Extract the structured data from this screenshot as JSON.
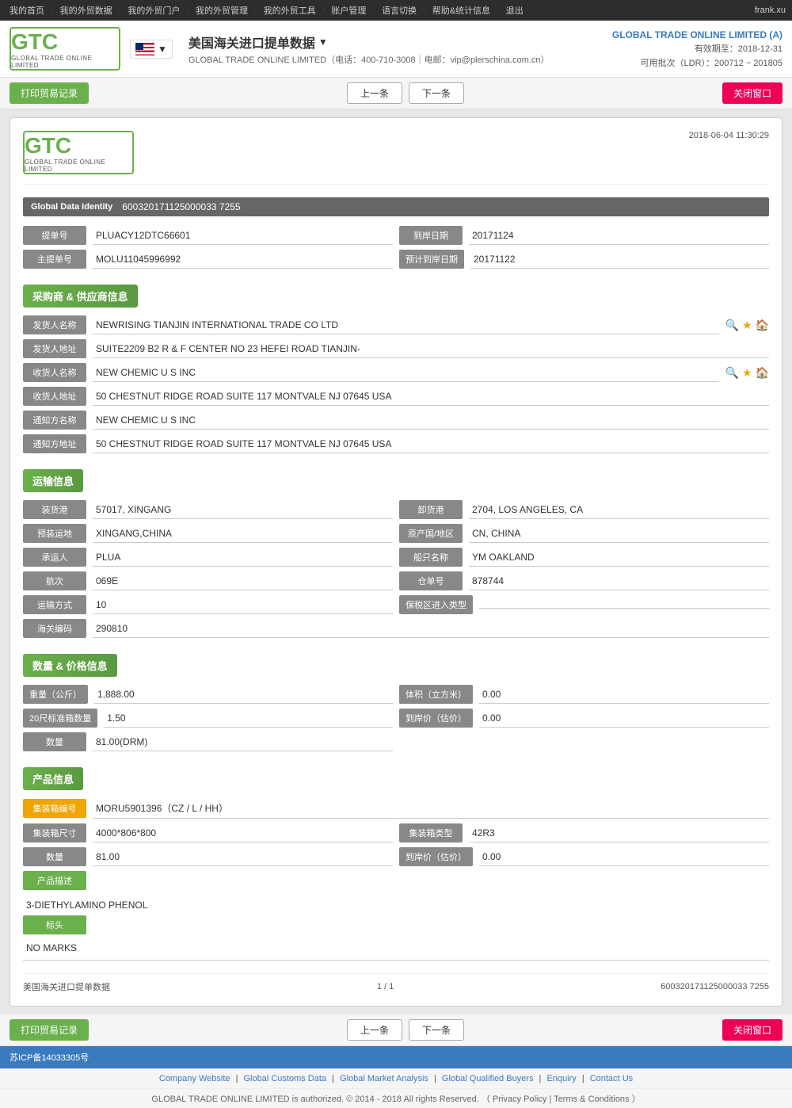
{
  "topNav": {
    "items": [
      "我的首页",
      "我的外贸数据",
      "我的外贸门户",
      "我的外贸管理",
      "我的外贸工具",
      "账户管理",
      "语言切换",
      "帮助&统计信息",
      "退出"
    ],
    "user": "frank.xu"
  },
  "header": {
    "title": "美国海关进口提单数据",
    "company_info": "GLOBAL TRADE ONLINE LIMITED（电话：400-710-3008｜电邮：vip@plerschina.com.cn）",
    "right_company": "GLOBAL TRADE ONLINE LIMITED (A)",
    "valid_until": "有效期至：2018-12-31",
    "ldr": "可用批次（LDR）：200712 ~ 201805"
  },
  "toolbar": {
    "print_label": "打印贸易记录",
    "prev_label": "上一条",
    "next_label": "下一条",
    "close_label": "关闭窗口"
  },
  "document": {
    "timestamp": "2018-06-04  11:30:29",
    "gdi_label": "Global Data Identity",
    "gdi_value": "600320171125000033 7255",
    "bill_no_label": "提单号",
    "bill_no_value": "PLUACY12DTC66601",
    "arrival_date_label": "到岸日期",
    "arrival_date_value": "20171124",
    "master_bill_label": "主提单号",
    "master_bill_value": "MOLU11045996992",
    "eta_label": "预计到岸日期",
    "eta_value": "20171122",
    "section_supplier": "采购商 & 供应商信息",
    "shipper_name_label": "发货人名称",
    "shipper_name_value": "NEWRISING TIANJIN INTERNATIONAL TRADE CO LTD",
    "shipper_addr_label": "发货人地址",
    "shipper_addr_value": "SUITE2209 B2 R & F CENTER NO 23 HEFEI ROAD TIANJIN-",
    "consignee_name_label": "收货人名称",
    "consignee_name_value": "NEW CHEMIC U S INC",
    "consignee_addr_label": "收货人地址",
    "consignee_addr_value": "50 CHESTNUT RIDGE ROAD SUITE 117 MONTVALE NJ 07645 USA",
    "notify_name_label": "通知方名称",
    "notify_name_value": "NEW CHEMIC U S INC",
    "notify_addr_label": "通知方地址",
    "notify_addr_value": "50 CHESTNUT RIDGE ROAD SUITE 117 MONTVALE NJ 07645 USA",
    "section_transport": "运输信息",
    "load_port_label": "装货港",
    "load_port_value": "57017, XINGANG",
    "discharge_port_label": "卸货港",
    "discharge_port_value": "2704, LOS ANGELES, CA",
    "load_place_label": "预装运地",
    "load_place_value": "XINGANG,CHINA",
    "origin_label": "原产国/地区",
    "origin_value": "CN, CHINA",
    "carrier_label": "承运人",
    "carrier_value": "PLUA",
    "vessel_label": "船只名称",
    "vessel_value": "YM OAKLAND",
    "voyage_label": "航次",
    "voyage_value": "069E",
    "container_no_label": "仓单号",
    "container_no_value": "878744",
    "transport_mode_label": "运输方式",
    "transport_mode_value": "10",
    "bonded_label": "保税区进入类型",
    "bonded_value": "",
    "customs_code_label": "海关编码",
    "customs_code_value": "290810",
    "section_quantity": "数量 & 价格信息",
    "weight_label": "重量（公斤）",
    "weight_value": "1,888.00",
    "volume_label": "体积（立方米）",
    "volume_value": "0.00",
    "container_20_label": "20尺标准箱数量",
    "container_20_value": "1.50",
    "arrival_price_label": "到岸价（估价）",
    "arrival_price_value": "0.00",
    "quantity_label": "数量",
    "quantity_value": "81.00(DRM)",
    "section_product": "产品信息",
    "container_no2_label": "集装箱编号",
    "container_no2_value": "MORU5901396（CZ / L / HH）",
    "container_size_label": "集装箱尺寸",
    "container_size_value": "4000*806*800",
    "container_type_label": "集装箱类型",
    "container_type_value": "42R3",
    "quantity2_label": "数量",
    "quantity2_value": "81.00",
    "arrival_price2_label": "到岸价（估价）",
    "arrival_price2_value": "0.00",
    "product_desc_label": "产品描述",
    "product_desc_value": "3-DIETHYLAMINO PHENOL",
    "mark_label": "标头",
    "mark_value": "NO MARKS",
    "footer_left": "美国海关进口提单数据",
    "footer_page": "1 / 1",
    "footer_gdi": "600320171125000033 7255"
  },
  "footer": {
    "icp": "苏ICP备14033305号",
    "links": [
      "Company Website",
      "Global Customs Data",
      "Global Market Analysis",
      "Global Qualified Buyers",
      "Enquiry",
      "Contact Us"
    ],
    "copyright": "GLOBAL TRADE ONLINE LIMITED is authorized. © 2014 - 2018 All rights Reserved. （ Privacy Policy | Terms & Conditions ）"
  }
}
